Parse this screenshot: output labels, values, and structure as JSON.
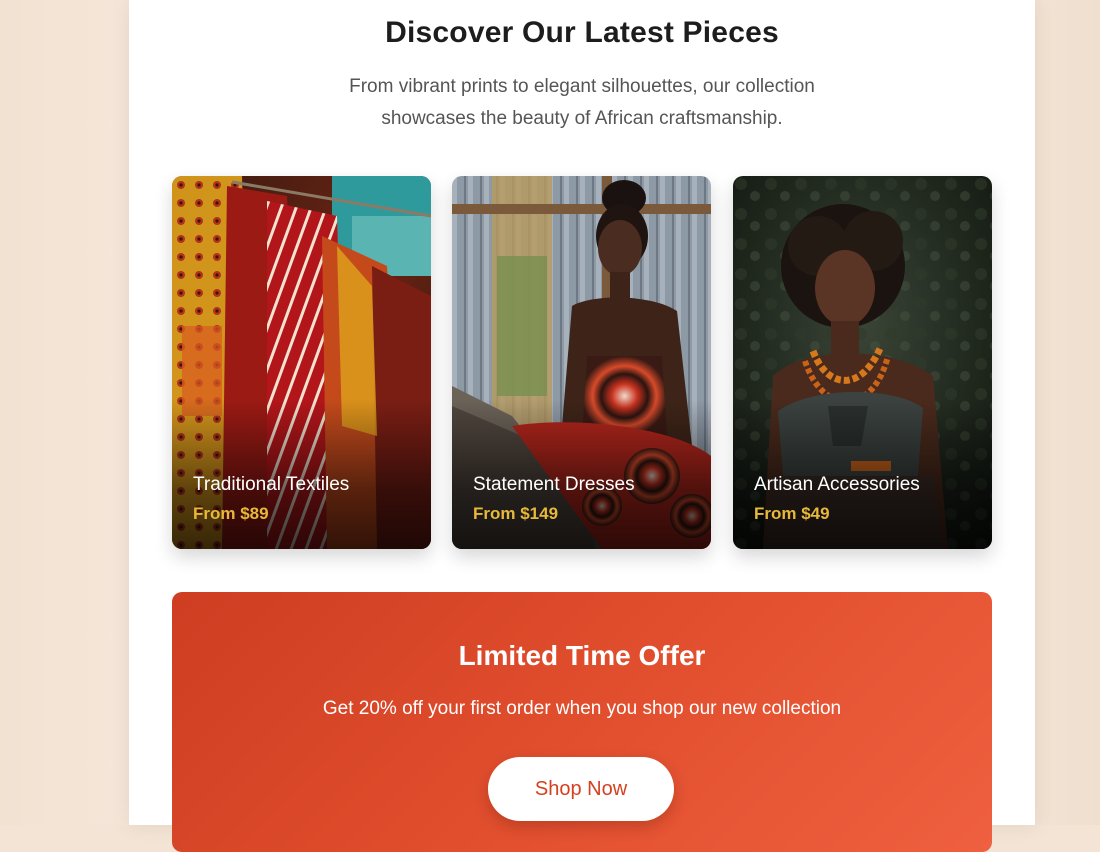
{
  "header": {
    "title": "Discover Our Latest Pieces",
    "subtitle_line1": "From vibrant prints to elegant silhouettes, our collection",
    "subtitle_line2": "showcases the beauty of African craftsmanship."
  },
  "products": [
    {
      "title": "Traditional Textiles",
      "price": "From $89"
    },
    {
      "title": "Statement Dresses",
      "price": "From $149"
    },
    {
      "title": "Artisan Accessories",
      "price": "From $49"
    }
  ],
  "offer": {
    "title": "Limited Time Offer",
    "text": "Get 20% off your first order when you shop our new collection",
    "button_label": "Shop Now"
  },
  "colors": {
    "accent": "#d5411f",
    "price": "#e8b83a",
    "page_background": "#f4e6d9"
  }
}
